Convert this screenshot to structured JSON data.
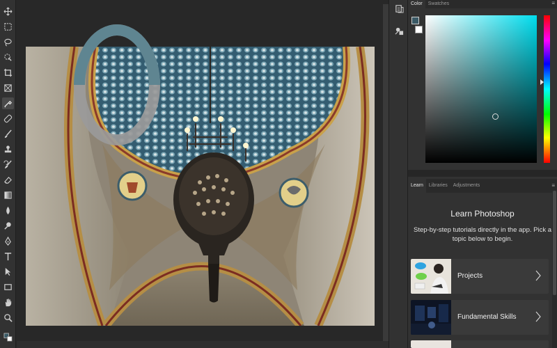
{
  "toolbar": {
    "tools": [
      "move-icon",
      "marquee-icon",
      "lasso-icon",
      "quick-select-icon",
      "crop-icon",
      "frame-icon",
      "eyedropper-icon",
      "healing-icon",
      "brush-icon",
      "stamp-icon",
      "history-brush-icon",
      "eraser-icon",
      "gradient-icon",
      "blur-icon",
      "dodge-icon",
      "pen-icon",
      "type-icon",
      "path-select-icon",
      "rectangle-icon",
      "hand-icon",
      "zoom-icon"
    ]
  },
  "color_panel": {
    "tabs": [
      "Color",
      "Swatches"
    ],
    "active_tab": "Color",
    "foreground_color": "#3b5a66",
    "background_color": "#ffffff",
    "picker_hue_color": "#00ddee"
  },
  "learn_panel": {
    "tabs": [
      "Learn",
      "Libraries",
      "Adjustments"
    ],
    "active_tab": "Learn",
    "title": "Learn Photoshop",
    "description": "Step-by-step tutorials directly in the app. Pick a topic below to begin.",
    "cards": [
      {
        "label": "Projects"
      },
      {
        "label": "Fundamental Skills"
      }
    ]
  },
  "loading_ring": {
    "progress_fraction": 0.5,
    "accent": "#5f8591",
    "track": "#9a9a9a"
  },
  "colors": {
    "app_bg": "#282828",
    "panel_bg": "#323232"
  }
}
